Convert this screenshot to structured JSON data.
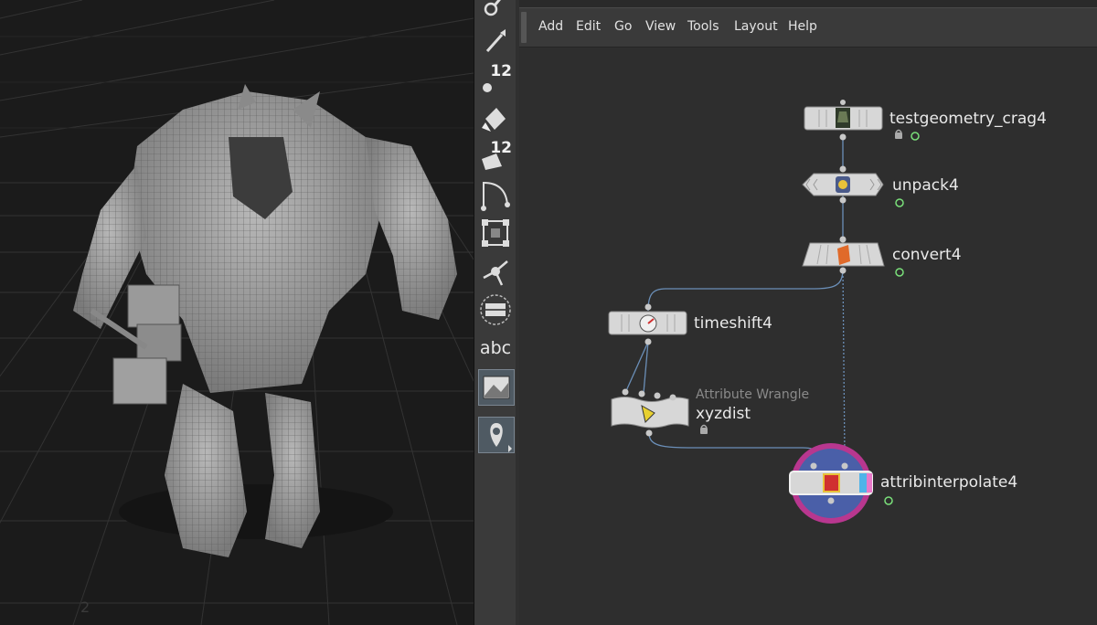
{
  "viewport": {
    "model_icon": "crag-character-model",
    "axis_marker": "2"
  },
  "toolbar": {
    "tools": [
      {
        "icon": "pose-brush-icon"
      },
      {
        "icon": "brush-tool-icon"
      },
      {
        "icon": "sculpt-count-icon",
        "badge": "12"
      },
      {
        "icon": "paint-bucket-icon"
      },
      {
        "icon": "stamp-tool-icon",
        "badge": "12"
      },
      {
        "icon": "curve-tool-icon"
      },
      {
        "icon": "lattice-icon"
      },
      {
        "icon": "handle-tool-icon"
      },
      {
        "icon": "plane-icon"
      },
      {
        "icon": "text-tool-icon",
        "text": "abc"
      },
      {
        "icon": "image-plane-icon"
      },
      {
        "icon": "pin-tool-icon"
      }
    ]
  },
  "menubar": {
    "items": [
      "Add",
      "Edit",
      "Go",
      "View",
      "Tools",
      "Layout",
      "Help"
    ]
  },
  "nodes": {
    "testgeometry": {
      "name": "testgeometry_crag4",
      "icon": "crag-geometry-icon"
    },
    "unpack": {
      "name": "unpack4",
      "icon": "unpack-icon"
    },
    "convert": {
      "name": "convert4",
      "icon": "convert-icon"
    },
    "timeshift": {
      "name": "timeshift4",
      "icon": "timeshift-gauge-icon"
    },
    "wrangle": {
      "name": "xyzdist",
      "comment": "Attribute Wrangle",
      "icon": "wrangle-icon"
    },
    "attribinterpolate": {
      "name": "attribinterpolate4",
      "icon": "attribinterpolate-icon"
    }
  },
  "colors": {
    "viewport_bg": "#1b1b1b",
    "network_bg": "#2e2e2e",
    "node_body": "#d7d7d7",
    "wire": "#6b8fb8",
    "render_flag": "#7ae07a",
    "display_ring": "#4a5fa8",
    "highlight_ring": "#b8378f",
    "flag_blue": "#4fb3e8",
    "flag_pink": "#e879c9"
  }
}
